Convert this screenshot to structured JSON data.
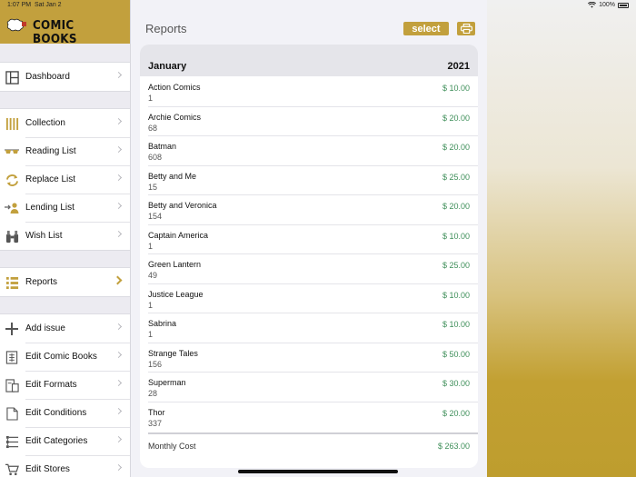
{
  "status": {
    "time": "1:07 PM",
    "date": "Sat Jan 2",
    "battery": "100%"
  },
  "colors": {
    "accent": "#c2a03d",
    "price": "#3f8f5a"
  },
  "brand": {
    "title": "COMIC BOOKS"
  },
  "sidebar": {
    "groups": [
      [
        {
          "label": "Dashboard",
          "icon": "dashboard-icon"
        }
      ],
      [
        {
          "label": "Collection",
          "icon": "collection-icon"
        },
        {
          "label": "Reading List",
          "icon": "glasses-icon"
        },
        {
          "label": "Replace List",
          "icon": "refresh-icon"
        },
        {
          "label": "Lending List",
          "icon": "lending-icon"
        },
        {
          "label": "Wish List",
          "icon": "binoculars-icon"
        }
      ],
      [
        {
          "label": "Reports",
          "icon": "reports-icon",
          "active": true
        }
      ],
      [
        {
          "label": "Add issue",
          "icon": "plus-icon"
        },
        {
          "label": "Edit Comic Books",
          "icon": "edit-books-icon"
        },
        {
          "label": "Edit Formats",
          "icon": "edit-formats-icon"
        },
        {
          "label": "Edit Conditions",
          "icon": "edit-conditions-icon"
        },
        {
          "label": "Edit Categories",
          "icon": "edit-categories-icon"
        },
        {
          "label": "Edit Stores",
          "icon": "cart-icon"
        }
      ]
    ]
  },
  "main": {
    "title": "Reports",
    "select_label": "select",
    "print_icon": "printer-icon",
    "report": {
      "month": "January",
      "year": "2021",
      "rows": [
        {
          "name": "Action Comics",
          "qty": "1",
          "price": "$  10.00"
        },
        {
          "name": "Archie Comics",
          "qty": "68",
          "price": "$  20.00"
        },
        {
          "name": "Batman",
          "qty": "608",
          "price": "$  20.00"
        },
        {
          "name": "Betty and Me",
          "qty": "15",
          "price": "$  25.00"
        },
        {
          "name": "Betty and Veronica",
          "qty": "154",
          "price": "$  20.00"
        },
        {
          "name": "Captain America",
          "qty": "1",
          "price": "$  10.00"
        },
        {
          "name": "Green Lantern",
          "qty": "49",
          "price": "$  25.00"
        },
        {
          "name": "Justice League",
          "qty": "1",
          "price": "$  10.00"
        },
        {
          "name": "Sabrina",
          "qty": "1",
          "price": "$  10.00"
        },
        {
          "name": "Strange Tales",
          "qty": "156",
          "price": "$  50.00"
        },
        {
          "name": "Superman",
          "qty": "28",
          "price": "$  30.00"
        },
        {
          "name": "Thor",
          "qty": "337",
          "price": "$  20.00"
        }
      ],
      "total_label": "Monthly Cost",
      "total_value": "$  263.00"
    }
  }
}
